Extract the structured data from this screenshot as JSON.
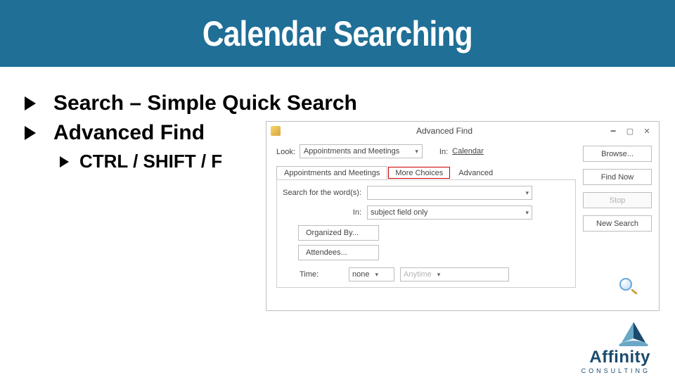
{
  "slide": {
    "title": "Calendar Searching",
    "bullets": [
      {
        "text": "Search – Simple Quick Search"
      },
      {
        "text": "Advanced Find"
      }
    ],
    "sub_bullets": [
      {
        "text": "CTRL / SHIFT / F"
      }
    ]
  },
  "advanced_find": {
    "window_title": "Advanced Find",
    "look_label": "Look:",
    "look_value": "Appointments and Meetings",
    "in_label": "In:",
    "in_value": "Calendar",
    "tabs": {
      "t1": "Appointments and Meetings",
      "t2": "More Choices",
      "t3": "Advanced"
    },
    "search_label": "Search for the word(s):",
    "search_value": "",
    "in_field_label": "In:",
    "in_field_value": "subject field only",
    "organized_by_btn": "Organized By...",
    "attendees_btn": "Attendees...",
    "time_label": "Time:",
    "time_value": "none",
    "time_range_value": "Anytime",
    "buttons": {
      "browse": "Browse...",
      "find_now": "Find Now",
      "stop": "Stop",
      "new_search": "New Search"
    }
  },
  "brand": {
    "name": "Affinity",
    "sub": "CONSULTING"
  },
  "colors": {
    "titlebar": "#1f6f97",
    "highlight": "#cc0000"
  }
}
